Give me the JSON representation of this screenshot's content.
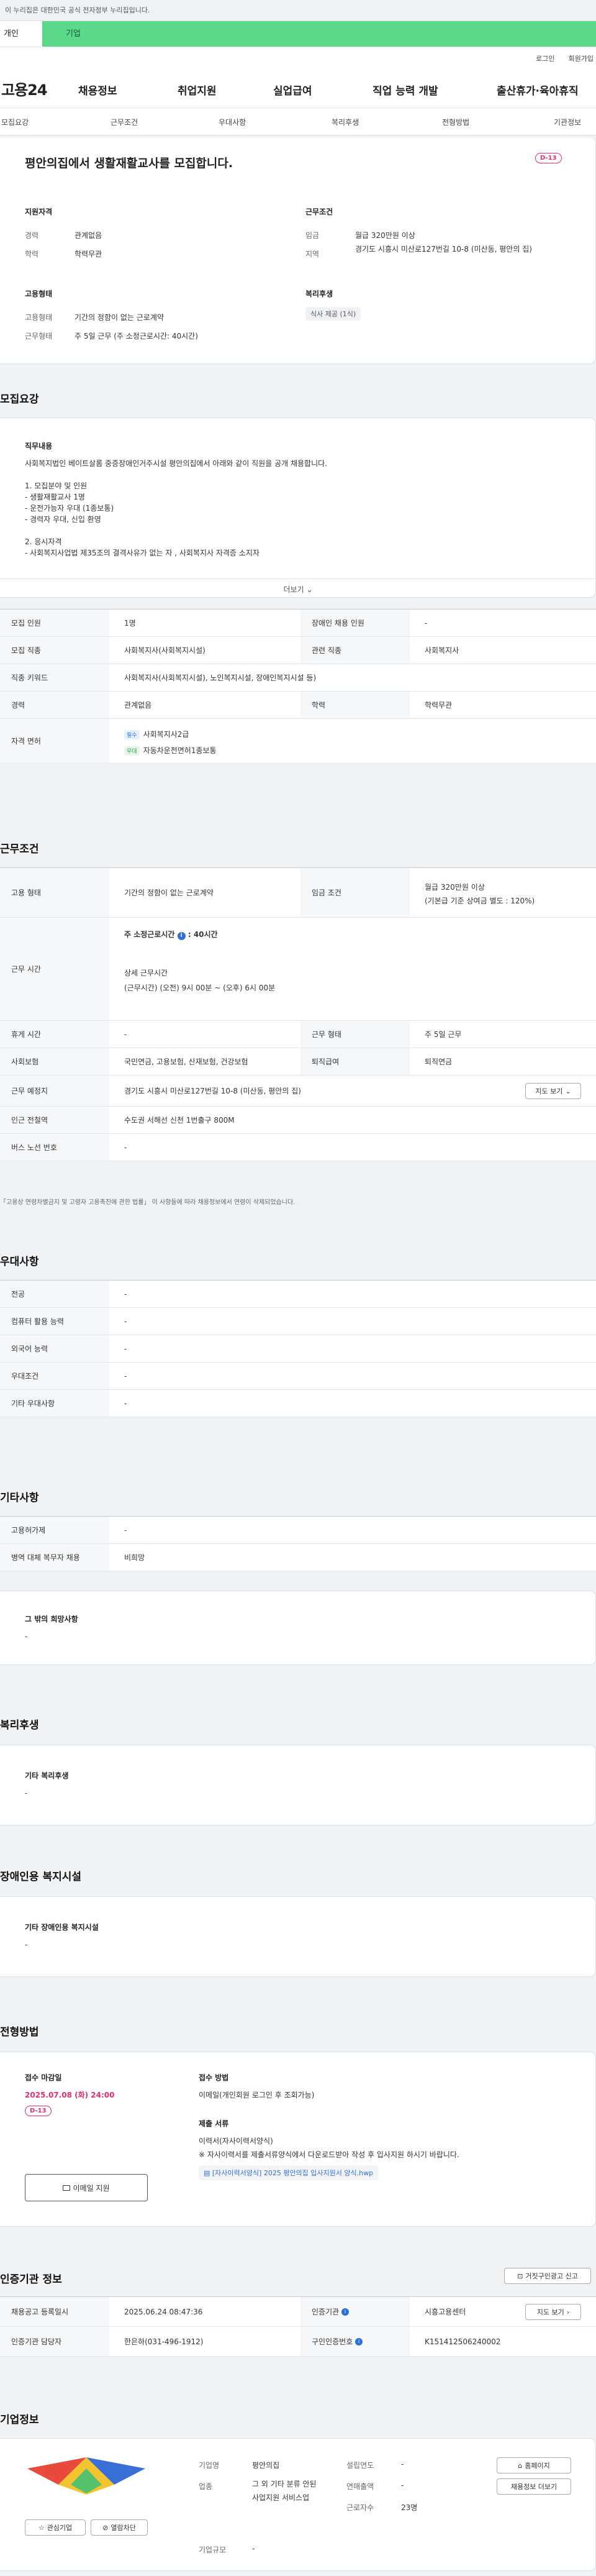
{
  "gov_banner": "이 누리집은 대한민국 공식 전자정부 누리집입니다.",
  "tabs": {
    "personal": "개인",
    "company": "기업"
  },
  "util": {
    "login": "로그인",
    "join": "회원가입"
  },
  "logo": "고용24",
  "nav": [
    "채용정보",
    "취업지원",
    "실업급여",
    "직업 능력 개발",
    "출산휴가·육아휴직"
  ],
  "subnav": [
    "모집요강",
    "근무조건",
    "우대사항",
    "복리후생",
    "전형방법",
    "기관정보"
  ],
  "summary": {
    "title": "평안의집에서 생활재활교사를 모집합니다.",
    "dday": "D-13",
    "h_qual": "지원자격",
    "career_k": "경력",
    "career_v": "관계없음",
    "edu_k": "학력",
    "edu_v": "학력무관",
    "h_cond": "근무조건",
    "wage_k": "임금",
    "wage_v": "월급 320만원 이상",
    "area_k": "지역",
    "area_v": "경기도 시흥시 미산로127번길 10-8 (미산동, 평안의 집)",
    "h_emp": "고용형태",
    "emp_k": "고용형태",
    "emp_v": "기간의 정함이 없는 근로계약",
    "work_k": "근무형태",
    "work_v": "주 5일 근무 (주 소정근로시간: 40시간)",
    "h_welf": "복리후생",
    "welf_badge": "식사 제공 (1식)"
  },
  "recruit": {
    "title": "모집요강",
    "h_job": "직무내용",
    "job_text": "사회복지법인 베이트살롬 중증장애인거주시설 평안의집에서 아래와 같이 직원을 공개 채용합니다.\n\n1. 모집분야 및 인원\n- 생활재활교사 1명\n- 운전가능자 우대 (1종보통)\n- 경력자 우대, 신입 환영\n\n2. 응시자격\n- 사회복지사업법 제35조의 결격사유가 없는 자 , 사회복지사 자격증 소지자",
    "more": "더보기",
    "rows": [
      {
        "k": "모집 인원",
        "v": "1명",
        "k2": "장애인 채용 인원",
        "v2": "-"
      },
      {
        "k": "모집 직종",
        "v": "사회복지사(사회복지시설)",
        "k2": "관련 직종",
        "v2": "사회복지사"
      },
      {
        "k": "직종 키워드",
        "v": "사회복지사(사회복지시설), 노인복지시설, 장애인복지시설 등)"
      },
      {
        "k": "경력",
        "v": "관계없음",
        "k2": "학력",
        "v2": "학력무관"
      }
    ],
    "license_k": "자격 면허",
    "lic1_tag": "필수",
    "lic1": "사회복지사2급",
    "lic2_tag": "우대",
    "lic2": "자동차운전면허1종보통"
  },
  "cond": {
    "title": "근무조건",
    "emp_k": "고용 형태",
    "emp_v": "기간의 정함이 없는 근로계약",
    "wage_k": "임금 조건",
    "wage_v1": "월급 320만원 이상",
    "wage_v2": "(기본급 기준 상여금 별도 : 120%)",
    "time_k": "근무 시간",
    "time_h": "주 소정근로시간",
    "time_hours": "40시간",
    "time_d": "상세 근무시간",
    "time_d2": "(근무시간) (오전) 9시 00분 ~ (오후) 6시 00분",
    "rest_k": "휴게 시간",
    "rest_v": "-",
    "form_k": "근무 형태",
    "form_v": "주 5일 근무",
    "ins_k": "사회보험",
    "ins_v": "국민연금, 고용보험, 산재보험, 건강보험",
    "ret_k": "퇴직급여",
    "ret_v": "퇴직연금",
    "place_k": "근무 예정지",
    "place_v": "경기도 시흥시 미산로127번길 10-8 (미산동, 평안의 집)",
    "map_btn": "지도 보기",
    "sub_k": "인근 전철역",
    "sub_v": "수도권 서해선 신천 1번출구 800M",
    "bus_k": "버스 노선 번호",
    "bus_v": "-",
    "note": "「고용상 연령차별금지 및 고령자 고용촉진에 관한 법률」 이 사항들에 따라 채용정보에서 연령이 삭제되었습니다."
  },
  "pref": {
    "title": "우대사항",
    "rows": [
      {
        "k": "전공",
        "v": "-"
      },
      {
        "k": "컴퓨터 활용 능력",
        "v": "-"
      },
      {
        "k": "외국어 능력",
        "v": "-"
      },
      {
        "k": "우대조건",
        "v": "-"
      },
      {
        "k": "기타 우대사항",
        "v": "-"
      }
    ]
  },
  "etc": {
    "title": "기타사항",
    "rows": [
      {
        "k": "고용허가제",
        "v": "-"
      },
      {
        "k": "병역 대체 복무자 채용",
        "v": "비희망"
      }
    ],
    "other_h": "그 밖의 희망사항",
    "other_v": "-"
  },
  "welfare": {
    "title": "복리후생",
    "h": "기타 복리후생",
    "v": "-"
  },
  "disab": {
    "title": "장애인용 복지시설",
    "h": "기타 장애인용 복지시설",
    "v": "-"
  },
  "apply": {
    "title": "전형방법",
    "deadline_h": "접수 마감일",
    "deadline": "2025.07.08 (화) 24:00",
    "dday": "D-13",
    "method_h": "접수 방법",
    "method_v": "이메일(개인회원 로그인 후 조회가능)",
    "docs_h": "제출 서류",
    "docs_v": "이력서(자사이력서양식)",
    "docs_note": "※ 자사이력서를 제출서류양식에서 다운로드받아 작성 후 입사지원 하시기 바랍니다.",
    "file_tag": "[자사이력서양식]",
    "file": "2025 평안의집 입사지원서 양식.hwp",
    "email_btn": "이메일 지원"
  },
  "auth": {
    "title": "인증기관 정보",
    "report_btn": "거짓구인광고 신고",
    "rows": [
      {
        "k": "채용공고 등록일시",
        "v": "2025.06.24 08:47:36",
        "k2": "인증기관",
        "v2": "시흥고용센터"
      },
      {
        "k": "인증기관 담당자",
        "v": "한은하(031-496-1912)",
        "k2": "구인인증번호",
        "v2": "K151412506240002"
      }
    ],
    "map_btn": "지도 보기"
  },
  "company": {
    "title": "기업정보",
    "fav_btn": "관심기업",
    "block_btn": "열람차단",
    "name_k": "기업명",
    "name_v": "평안의집",
    "year_k": "설립연도",
    "year_v": "-",
    "ind_k": "업종",
    "ind_v": "그 외 기타 분류 안된 사업지원 서비스업",
    "sales_k": "연매출액",
    "sales_v": "-",
    "emp_k": "근로자수",
    "emp_v": "23명",
    "size_k": "기업규모",
    "size_v": "-",
    "home_btn": "홈페이지",
    "more_btn": "채용정보 더보기"
  },
  "colors": {
    "accent": "#5cd88a",
    "dday": "#e3306b",
    "link": "#2f6fd6"
  }
}
